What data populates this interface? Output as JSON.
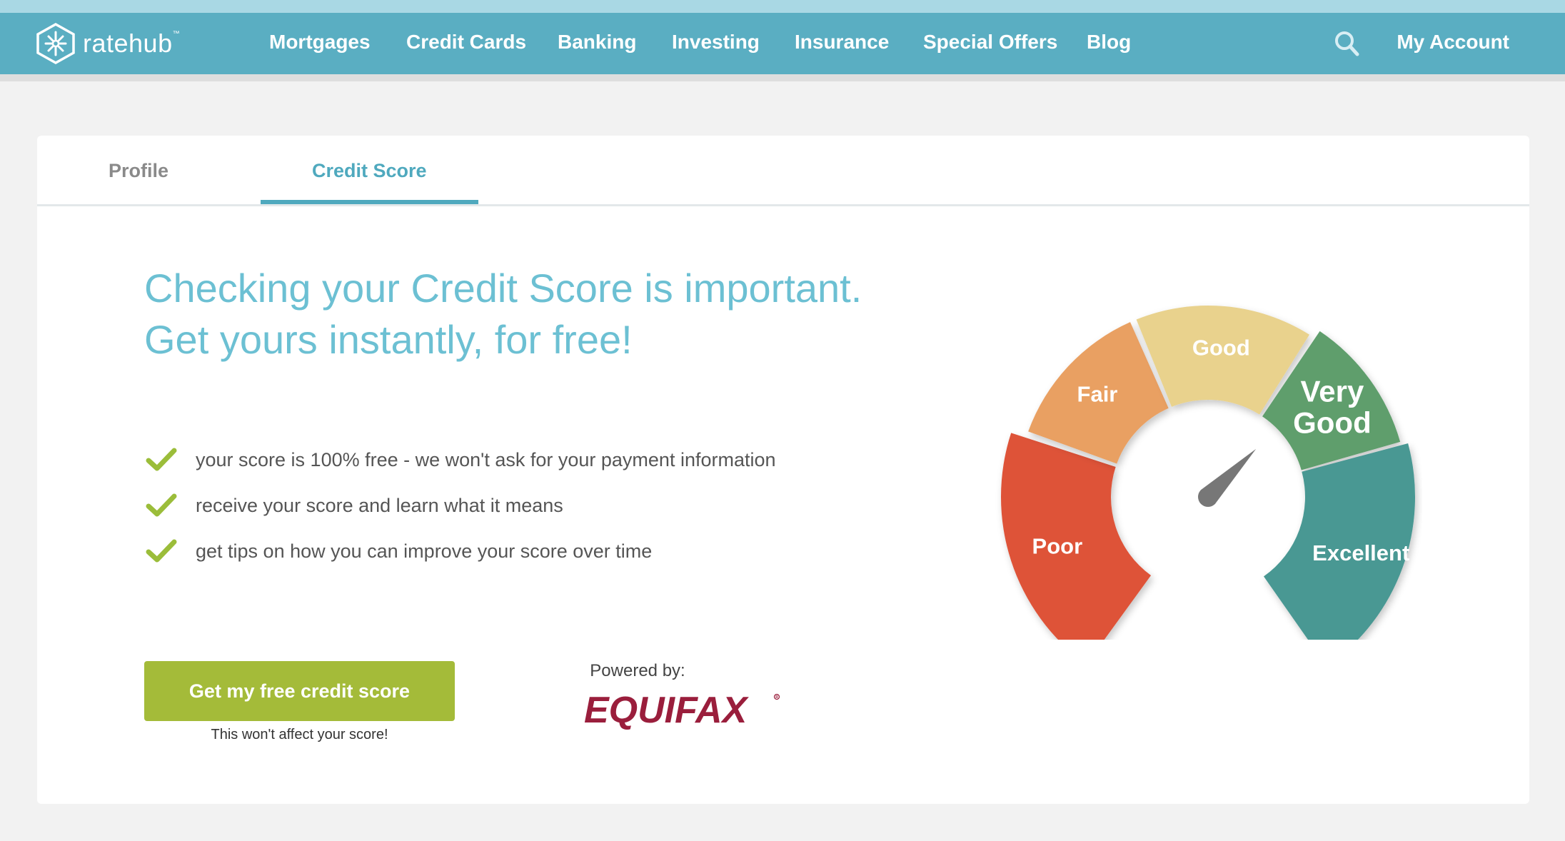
{
  "header": {
    "brand": "ratehub",
    "brand_mark": "™",
    "nav": [
      "Mortgages",
      "Credit Cards",
      "Banking",
      "Investing",
      "Insurance",
      "Special Offers",
      "Blog"
    ],
    "account": "My Account",
    "colors": {
      "bar": "#5aaec2",
      "strip": "#a9d8e4"
    },
    "icons": {
      "logo": "ratehub-logo-icon",
      "search": "search-icon"
    }
  },
  "tabs": {
    "profile": "Profile",
    "credit_score": "Credit Score",
    "active": "Credit Score"
  },
  "main": {
    "headline_line1": "Checking your Credit Score is important.",
    "headline_line2": "Get yours instantly, for free!",
    "benefits": [
      "your score is 100% free - we won't ask for your payment information",
      "receive your score and learn what it means",
      "get tips on how you can improve your score over time"
    ],
    "cta_label": "Get my free credit score",
    "cta_note": "This won't affect your score!",
    "powered_by": "Powered by:",
    "partner_logo": "EQUIFAX",
    "colors": {
      "accent": "#6cc0d3",
      "cta": "#a4bb39",
      "check": "#9bbd3a",
      "partner": "#9a1e3c"
    }
  },
  "gauge": {
    "segments": [
      {
        "label": "Poor",
        "color": "#de5338"
      },
      {
        "label": "Fair",
        "color": "#e9a062"
      },
      {
        "label": "Good",
        "color": "#e9d28d"
      },
      {
        "label": "Very Good",
        "color": "#5e9e6c"
      },
      {
        "label": "Excellent",
        "color": "#489893"
      }
    ],
    "needle_color": "#777777"
  }
}
